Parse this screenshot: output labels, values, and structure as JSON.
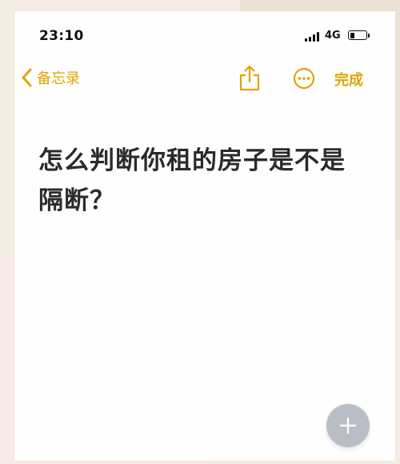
{
  "status_bar": {
    "time": "23:10",
    "network": "4G"
  },
  "nav": {
    "back_label": "备忘录",
    "done_label": "完成"
  },
  "note": {
    "title": "怎么判断你租的房子是不是隔断？"
  },
  "icons": {
    "back": "chevron-left-icon",
    "share": "share-icon",
    "more": "ellipsis-circle-icon",
    "add": "plus-icon"
  },
  "colors": {
    "accent": "#e0a400",
    "text": "#2b2b2b",
    "fab": "#b9bec6"
  }
}
